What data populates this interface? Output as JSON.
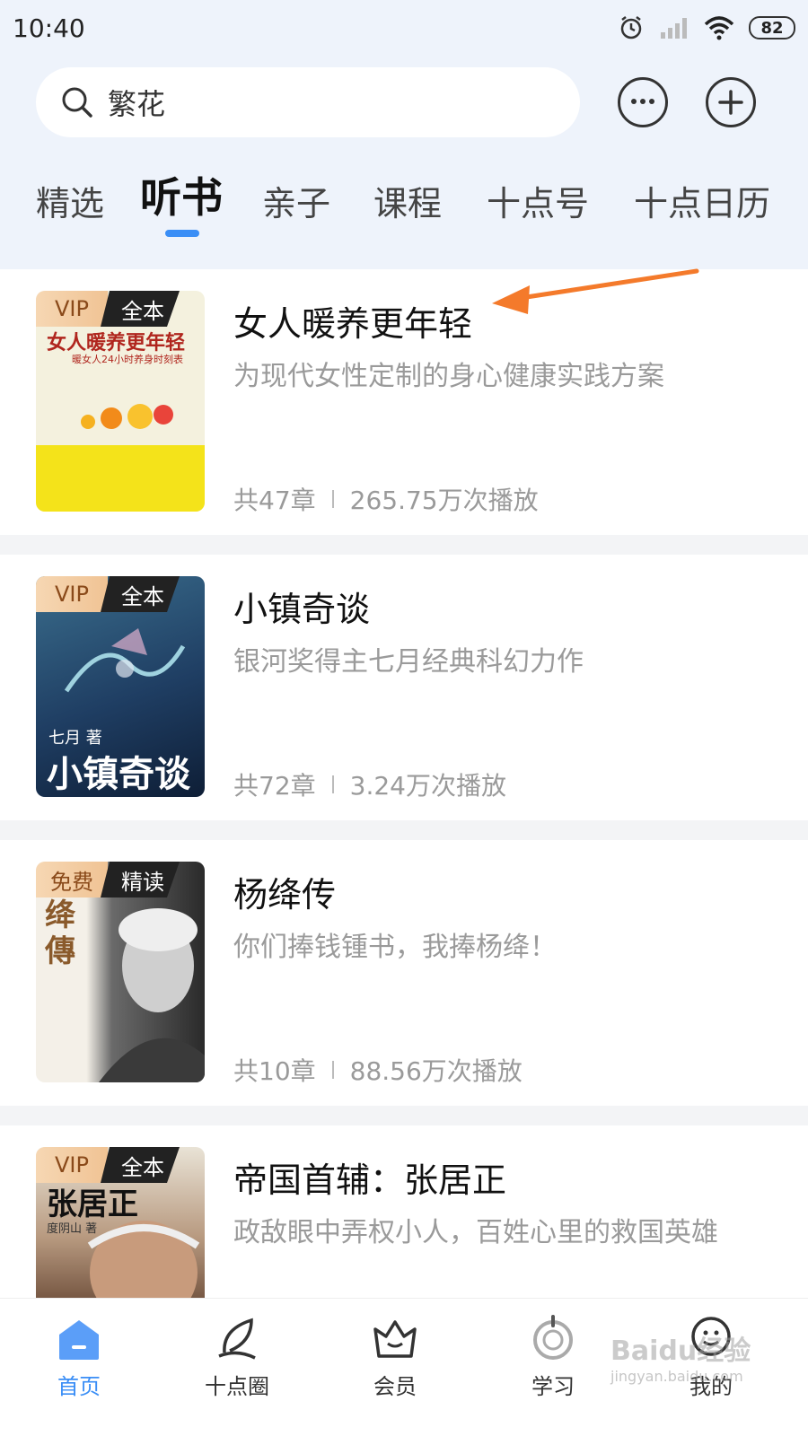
{
  "status_bar": {
    "time": "10:40",
    "battery": "82"
  },
  "search": {
    "query": "繁花"
  },
  "tabs": [
    {
      "label": "精选"
    },
    {
      "label": "听书"
    },
    {
      "label": "亲子"
    },
    {
      "label": "课程"
    },
    {
      "label": "十点号"
    },
    {
      "label": "十点日历"
    }
  ],
  "active_tab": "听书",
  "books": [
    {
      "badge_left": "VIP",
      "badge_right": "全本",
      "cover_text": "女人暖养更年轻",
      "cover_subtext": "暖女人24小时养身时刻表",
      "title": "女人暖养更年轻",
      "desc": "为现代女性定制的身心健康实践方案",
      "chapters": "共47章",
      "plays": "265.75万次播放"
    },
    {
      "badge_left": "VIP",
      "badge_right": "全本",
      "cover_text": "小镇奇谈",
      "cover_author": "七月 著",
      "title": "小镇奇谈",
      "desc": "银河奖得主七月经典科幻力作",
      "chapters": "共72章",
      "plays": "3.24万次播放"
    },
    {
      "badge_left": "免费",
      "badge_right": "精读",
      "cover_text": "绛傳",
      "title": "杨绛传",
      "desc": "你们捧钱锺书，我捧杨绛！",
      "chapters": "共10章",
      "plays": "88.56万次播放"
    },
    {
      "badge_left": "VIP",
      "badge_right": "全本",
      "cover_text": "张居正",
      "cover_author": "度阴山 著",
      "title": "帝国首辅：张居正",
      "desc": "政敌眼中弄权小人，百姓心里的救国英雄"
    }
  ],
  "bottom_nav": [
    {
      "label": "首页",
      "icon": "home-icon"
    },
    {
      "label": "十点圈",
      "icon": "feather-icon"
    },
    {
      "label": "会员",
      "icon": "crown-icon"
    },
    {
      "label": "学习",
      "icon": "study-icon"
    },
    {
      "label": "我的",
      "icon": "profile-icon"
    }
  ],
  "watermark": {
    "text": "Baidu经验",
    "url_text": "jingyan.baidu.com"
  },
  "colors": {
    "accent": "#3a8ef6",
    "arrow": "#f47a2b"
  }
}
